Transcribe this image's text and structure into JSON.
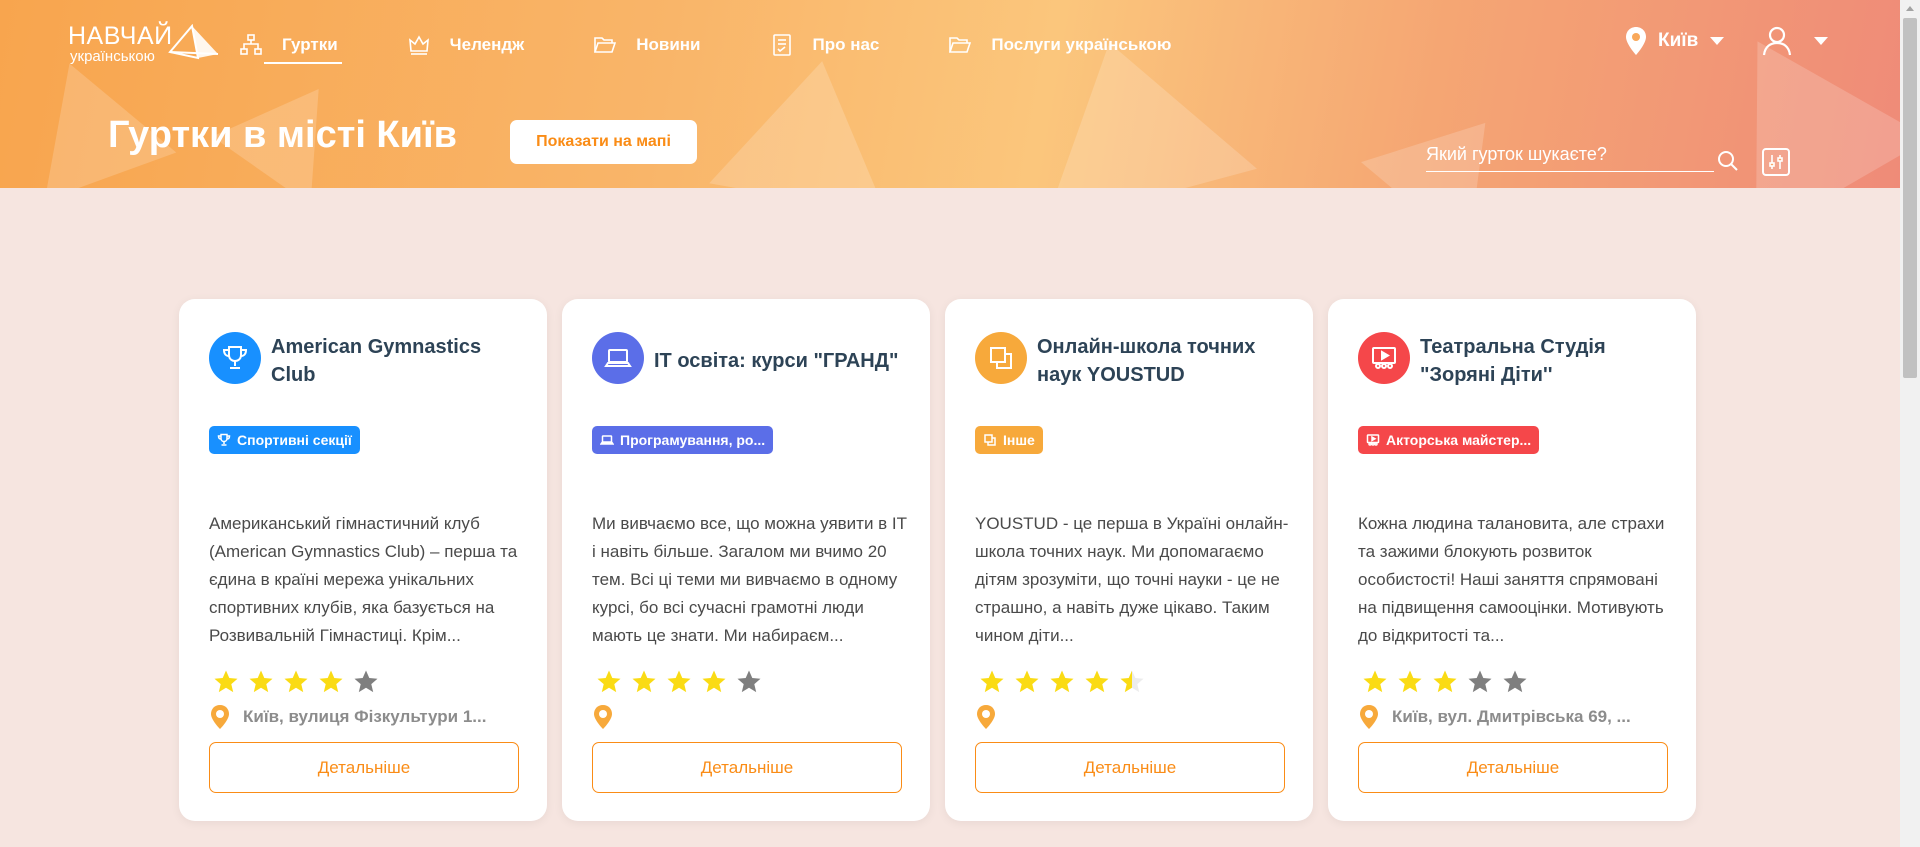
{
  "logo": {
    "line1": "НАВЧАЙ",
    "line2": "українською"
  },
  "nav": [
    {
      "label": "Гуртки",
      "icon": "hierarchy-icon",
      "active": true
    },
    {
      "label": "Челендж",
      "icon": "crown-icon",
      "active": false
    },
    {
      "label": "Новини",
      "icon": "folder-open-icon",
      "active": false
    },
    {
      "label": "Про нас",
      "icon": "document-icon",
      "active": false
    },
    {
      "label": "Послуги українською",
      "icon": "folder-open-icon",
      "active": false
    }
  ],
  "header": {
    "city": "Київ",
    "title": "Гуртки в місті Київ",
    "map_button": "Показати на мапі",
    "search_placeholder": "Який гурток шукаєте?"
  },
  "colors": {
    "accent": "#fa8c16",
    "sport": "#1890ff",
    "programming": "#5b6ee8",
    "other": "#f7a93b",
    "acting": "#f5474a",
    "star_filled": "#fadb14",
    "star_empty": "#7f7f7f"
  },
  "cards": [
    {
      "title": "American Gymnastics Club",
      "icon": "trophy-icon",
      "color": "#1890ff",
      "tag": "Спортивні секції",
      "description": "Американський гімнастичний клуб (American Gymnastics Club) – перша та єдина в країні мережа унікальних спортивних клубів, яка базується на Розвивальній Гімнастиці. Крім...",
      "rating": 4,
      "address": "Київ, вулиця Фізкультури 1...",
      "button": "Детальніше"
    },
    {
      "title": "IT освіта: курси \"ГРАНД\"",
      "icon": "laptop-icon",
      "color": "#5b6ee8",
      "tag": "Програмування, ро...",
      "description": "Ми вивчаємо все, що можна уявити в IT і навіть більше. Загалом ми вчимо 20 тем. Всі ці теми ми вивчаємо в одному курсі, бо всі сучасні грамотні люди мають це знати. Ми набираєм...",
      "rating": 4,
      "address": "",
      "button": "Детальніше"
    },
    {
      "title": "Онлайн-школа точних наук YOUSTUD",
      "icon": "copy-icon",
      "color": "#f7a93b",
      "tag": "Інше",
      "description": "YOUSTUD - це перша в Україні онлайн-школа точних наук. Ми допомагаємо дітям зрозуміти, що точні науки - це не страшно, а навіть дуже цікаво. Таким чином діти...",
      "rating": 4.5,
      "address": "",
      "button": "Детальніше"
    },
    {
      "title": "Театральна Студія \"Зоряні Діти''",
      "icon": "theater-icon",
      "color": "#f5474a",
      "tag": "Акторська майстер...",
      "description": "Кожна людина талановита, але страхи та зажими блокують розвиток особистості! Наші заняття спрямовані на підвищення самооцінки. Мотивують до відкритості та...",
      "rating": 3,
      "address": "Київ, вул. Дмитрівська 69, ...",
      "button": "Детальніше"
    }
  ]
}
